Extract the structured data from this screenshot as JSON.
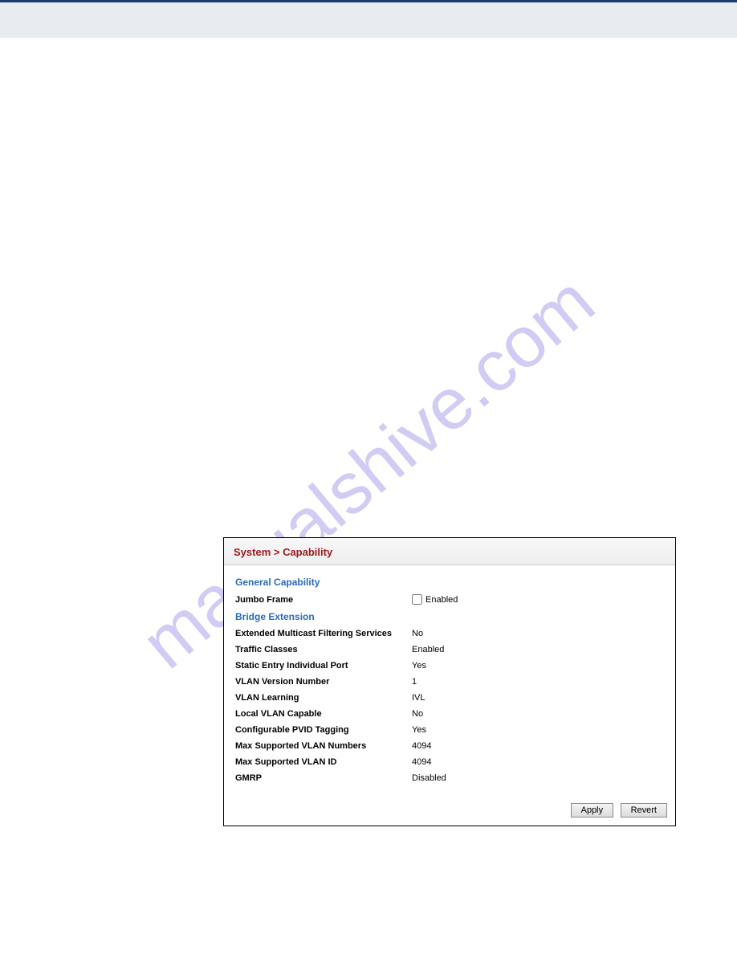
{
  "watermark": "manualshive.com",
  "panel": {
    "title": "System > Capability",
    "general_label": "General Capability",
    "jumbo_label": "Jumbo Frame",
    "jumbo_checkbox_label": "Enabled",
    "bridge_label": "Bridge Extension",
    "rows": [
      {
        "label": "Extended Multicast Filtering Services",
        "value": "No"
      },
      {
        "label": "Traffic Classes",
        "value": "Enabled"
      },
      {
        "label": "Static Entry Individual Port",
        "value": "Yes"
      },
      {
        "label": "VLAN Version Number",
        "value": "1"
      },
      {
        "label": "VLAN Learning",
        "value": "IVL"
      },
      {
        "label": "Local VLAN Capable",
        "value": "No"
      },
      {
        "label": "Configurable PVID Tagging",
        "value": "Yes"
      },
      {
        "label": "Max Supported VLAN Numbers",
        "value": "4094"
      },
      {
        "label": "Max Supported VLAN ID",
        "value": "4094"
      },
      {
        "label": "GMRP",
        "value": "Disabled"
      }
    ],
    "apply_label": "Apply",
    "revert_label": "Revert"
  }
}
